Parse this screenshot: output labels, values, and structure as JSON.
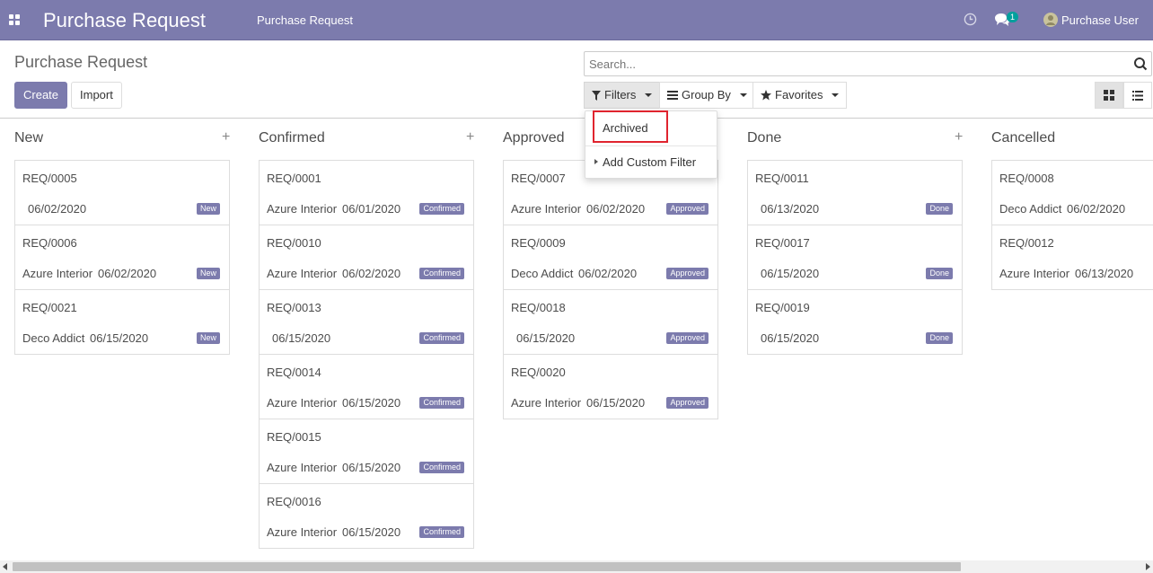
{
  "navbar": {
    "brand": "Purchase Request",
    "menu_item": "Purchase Request",
    "chat_count": "1",
    "user_name": "Purchase User",
    "bg_color": "#7c7bad"
  },
  "control_panel": {
    "breadcrumb": "Purchase Request",
    "create_label": "Create",
    "import_label": "Import",
    "search_placeholder": "Search...",
    "filters_label": "Filters",
    "groupby_label": "Group By",
    "favorites_label": "Favorites"
  },
  "filters_dropdown": {
    "archived": "Archived",
    "add_custom_filter": "Add Custom Filter"
  },
  "columns": [
    {
      "title": "New",
      "cards": [
        {
          "ref": "REQ/0005",
          "partner": "",
          "date": "06/02/2020",
          "state": "New"
        },
        {
          "ref": "REQ/0006",
          "partner": "Azure Interior",
          "date": "06/02/2020",
          "state": "New"
        },
        {
          "ref": "REQ/0021",
          "partner": "Deco Addict",
          "date": "06/15/2020",
          "state": "New"
        }
      ]
    },
    {
      "title": "Confirmed",
      "cards": [
        {
          "ref": "REQ/0001",
          "partner": "Azure Interior",
          "date": "06/01/2020",
          "state": "Confirmed"
        },
        {
          "ref": "REQ/0010",
          "partner": "Azure Interior",
          "date": "06/02/2020",
          "state": "Confirmed"
        },
        {
          "ref": "REQ/0013",
          "partner": "",
          "date": "06/15/2020",
          "state": "Confirmed"
        },
        {
          "ref": "REQ/0014",
          "partner": "Azure Interior",
          "date": "06/15/2020",
          "state": "Confirmed"
        },
        {
          "ref": "REQ/0015",
          "partner": "Azure Interior",
          "date": "06/15/2020",
          "state": "Confirmed"
        },
        {
          "ref": "REQ/0016",
          "partner": "Azure Interior",
          "date": "06/15/2020",
          "state": "Confirmed"
        }
      ]
    },
    {
      "title": "Approved",
      "cards": [
        {
          "ref": "REQ/0007",
          "partner": "Azure Interior",
          "date": "06/02/2020",
          "state": "Approved"
        },
        {
          "ref": "REQ/0009",
          "partner": "Deco Addict",
          "date": "06/02/2020",
          "state": "Approved"
        },
        {
          "ref": "REQ/0018",
          "partner": "",
          "date": "06/15/2020",
          "state": "Approved"
        },
        {
          "ref": "REQ/0020",
          "partner": "Azure Interior",
          "date": "06/15/2020",
          "state": "Approved"
        }
      ]
    },
    {
      "title": "Done",
      "cards": [
        {
          "ref": "REQ/0011",
          "partner": "",
          "date": "06/13/2020",
          "state": "Done"
        },
        {
          "ref": "REQ/0017",
          "partner": "",
          "date": "06/15/2020",
          "state": "Done"
        },
        {
          "ref": "REQ/0019",
          "partner": "",
          "date": "06/15/2020",
          "state": "Done"
        }
      ]
    },
    {
      "title": "Cancelled",
      "cards": [
        {
          "ref": "REQ/0008",
          "partner": "Deco Addict",
          "date": "06/02/2020",
          "state": ""
        },
        {
          "ref": "REQ/0012",
          "partner": "Azure Interior",
          "date": "06/13/2020",
          "state": ""
        }
      ]
    }
  ]
}
